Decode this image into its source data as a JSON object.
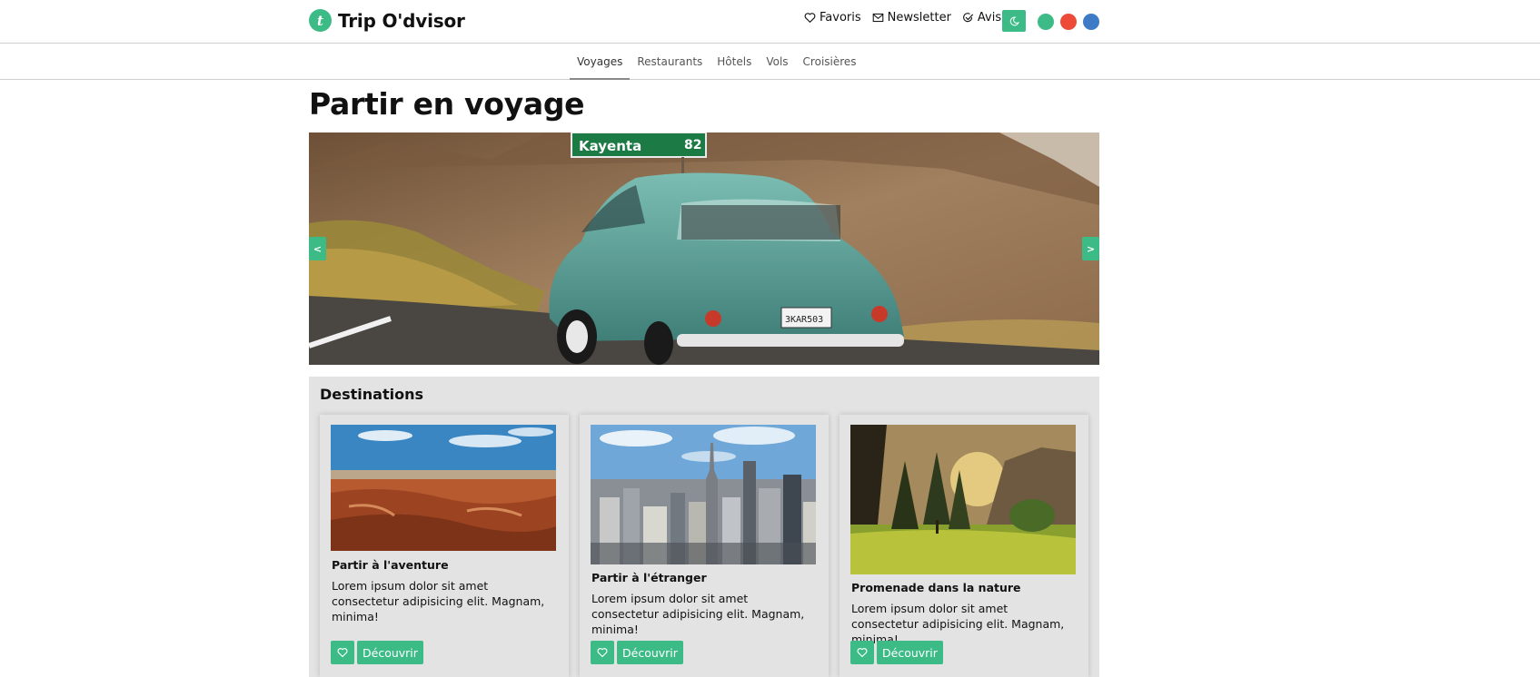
{
  "header": {
    "logo_letter": "t",
    "site_name": "Trip O'dvisor",
    "links": [
      {
        "label": "Favoris",
        "icon": "heart-icon"
      },
      {
        "label": "Newsletter",
        "icon": "mail-icon"
      },
      {
        "label": "Avis",
        "icon": "check-circle-icon"
      }
    ],
    "theme_icon": "moon-icon",
    "color_options": [
      "#3dbb86",
      "#ee4a3a",
      "#3e7bc6"
    ]
  },
  "subnav": {
    "items": [
      "Voyages",
      "Restaurants",
      "Hôtels",
      "Vols",
      "Croisières"
    ],
    "active": "Voyages"
  },
  "page": {
    "title": "Partir en voyage"
  },
  "hero": {
    "prev_label": "<",
    "next_label": ">",
    "sign_text": "Kayenta",
    "sign_number": "82",
    "plate_text": "3KAR503"
  },
  "destinations": {
    "title": "Destinations",
    "cards": [
      {
        "title": "Partir à l'aventure",
        "text": "Lorem ipsum dolor sit amet consectetur adipisicing elit. Magnam, minima!",
        "button": "Découvrir",
        "image": "desert-canyon"
      },
      {
        "title": "Partir à l'étranger",
        "text": "Lorem ipsum dolor sit amet consectetur adipisicing elit. Magnam, minima!",
        "button": "Découvrir",
        "image": "city-skyline"
      },
      {
        "title": "Promenade dans la nature",
        "text": "Lorem ipsum dolor sit amet consectetur adipisicing elit. Magnam, minima!",
        "button": "Découvrir",
        "image": "forest-meadow"
      }
    ]
  },
  "colors": {
    "accent": "#3dbb86",
    "panel": "#e3e3e3"
  }
}
